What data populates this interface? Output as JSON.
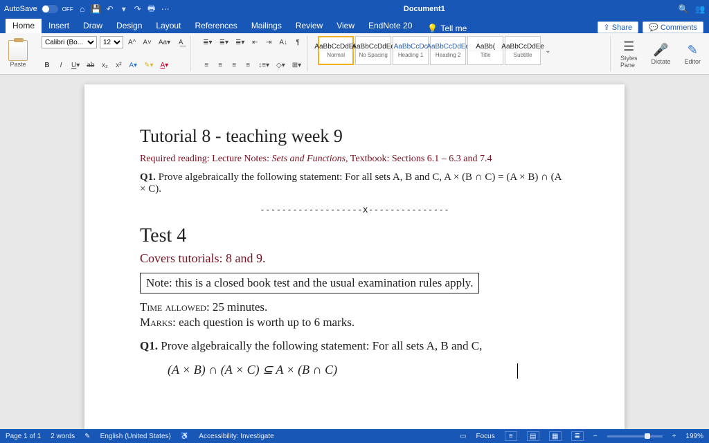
{
  "titlebar": {
    "autosave_label": "AutoSave",
    "autosave_state": "OFF",
    "doc_title": "Document1"
  },
  "tabs": {
    "items": [
      "Home",
      "Insert",
      "Draw",
      "Design",
      "Layout",
      "References",
      "Mailings",
      "Review",
      "View",
      "EndNote 20"
    ],
    "active": 0,
    "tellme": "Tell me",
    "share": "Share",
    "comments": "Comments"
  },
  "ribbon": {
    "paste": "Paste",
    "font_name": "Calibri (Bo...",
    "font_size": "12",
    "styles": [
      {
        "preview": "AaBbCcDdEe",
        "name": "Normal",
        "sel": true,
        "blue": false
      },
      {
        "preview": "AaBbCcDdEe",
        "name": "No Spacing",
        "sel": false,
        "blue": false
      },
      {
        "preview": "AaBbCcDc",
        "name": "Heading 1",
        "sel": false,
        "blue": true
      },
      {
        "preview": "AaBbCcDdEe",
        "name": "Heading 2",
        "sel": false,
        "blue": true
      },
      {
        "preview": "AaBb(",
        "name": "Title",
        "sel": false,
        "blue": false
      },
      {
        "preview": "AaBbCcDdEe",
        "name": "Subtitle",
        "sel": false,
        "blue": false
      }
    ],
    "styles_pane": "Styles\nPane",
    "dictate": "Dictate",
    "editor": "Editor"
  },
  "document": {
    "title1": "Tutorial 8 - teaching week 9",
    "reading_prefix": "Required reading: Lecture Notes: ",
    "reading_em": "Sets and Functions",
    "reading_suffix": ", Textbook: Sections 6.1 – 6.3 and 7.4",
    "q1_label": "Q1.",
    "q1_text": " Prove algebraically the following statement: For all sets A, B and C, A × (B ∩ C) = (A × B) ∩ (A × C).",
    "divider": "-------------------x---------------",
    "title2": "Test 4",
    "covers": "Covers tutorials: 8 and 9.",
    "boxnote": "Note: this is a closed book test and the usual examination rules apply.",
    "time_label": "Time allowed",
    "time_value": ": 25 minutes.",
    "marks_label": "Marks",
    "marks_value": ": each question is worth up to 6 marks.",
    "q1b_label": "Q1.",
    "q1b_text": " Prove algebraically the following statement: For all sets A, B and C,",
    "math": "(A × B) ∩ (A × C) ⊆ A × (B ∩ C)"
  },
  "statusbar": {
    "page": "Page 1 of 1",
    "words": "2 words",
    "lang": "English (United States)",
    "access": "Accessibility: Investigate",
    "focus": "Focus",
    "zoom": "199%"
  }
}
